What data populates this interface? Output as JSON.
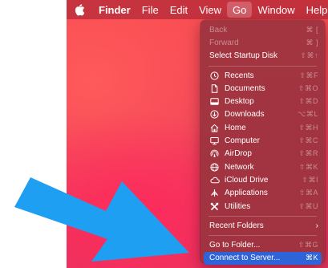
{
  "menubar": {
    "apple_label": "",
    "items": [
      {
        "label": "Finder"
      },
      {
        "label": "File"
      },
      {
        "label": "Edit"
      },
      {
        "label": "View"
      },
      {
        "label": "Go"
      },
      {
        "label": "Window"
      },
      {
        "label": "Help"
      }
    ]
  },
  "go_menu": {
    "back": {
      "label": "Back",
      "shortcut": "⌘ ["
    },
    "forward": {
      "label": "Forward",
      "shortcut": "⌘ ]"
    },
    "startup": {
      "label": "Select Startup Disk",
      "shortcut": "⇧⌘↑"
    },
    "places": [
      {
        "label": "Recents",
        "shortcut": "⇧⌘F",
        "icon": "clock-icon"
      },
      {
        "label": "Documents",
        "shortcut": "⇧⌘O",
        "icon": "document-icon"
      },
      {
        "label": "Desktop",
        "shortcut": "⇧⌘D",
        "icon": "desktop-icon"
      },
      {
        "label": "Downloads",
        "shortcut": "⌥⌘L",
        "icon": "download-icon"
      },
      {
        "label": "Home",
        "shortcut": "⇧⌘H",
        "icon": "home-icon"
      },
      {
        "label": "Computer",
        "shortcut": "⇧⌘C",
        "icon": "computer-icon"
      },
      {
        "label": "AirDrop",
        "shortcut": "⇧⌘R",
        "icon": "airdrop-icon"
      },
      {
        "label": "Network",
        "shortcut": "⇧⌘K",
        "icon": "network-icon"
      },
      {
        "label": "iCloud Drive",
        "shortcut": "⇧⌘I",
        "icon": "cloud-icon"
      },
      {
        "label": "Applications",
        "shortcut": "⇧⌘A",
        "icon": "applications-icon"
      },
      {
        "label": "Utilities",
        "shortcut": "⇧⌘U",
        "icon": "utilities-icon"
      }
    ],
    "recent_folders": {
      "label": "Recent Folders",
      "arrow": "›"
    },
    "go_to_folder": {
      "label": "Go to Folder...",
      "shortcut": "⇧⌘G"
    },
    "connect": {
      "label": "Connect to Server...",
      "shortcut": "⌘K"
    }
  },
  "colors": {
    "menu_bg": "#9b343e",
    "highlight": "#2f63d8",
    "arrow": "#1e9ff2"
  }
}
